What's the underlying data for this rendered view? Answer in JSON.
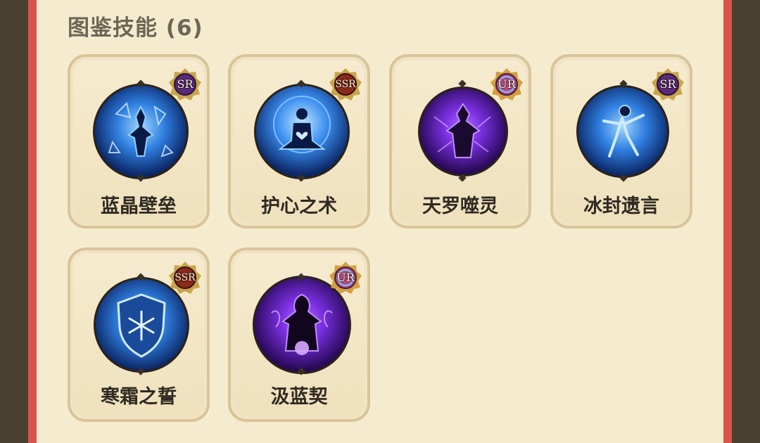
{
  "section": {
    "title": "图鉴技能 (6)"
  },
  "skills": [
    {
      "name": "蓝晶壁垒",
      "rarity": "SR",
      "icon": "crystal-guardian-icon"
    },
    {
      "name": "护心之术",
      "rarity": "SSR",
      "icon": "meditation-heart-icon"
    },
    {
      "name": "天罗噬灵",
      "rarity": "UR",
      "icon": "shadow-warrior-icon"
    },
    {
      "name": "冰封遗言",
      "rarity": "SR",
      "icon": "ice-spirit-icon"
    },
    {
      "name": "寒霜之誓",
      "rarity": "SSR",
      "icon": "frost-shield-icon"
    },
    {
      "name": "汲蓝契",
      "rarity": "UR",
      "icon": "dark-sorcerer-icon"
    }
  ],
  "colors": {
    "panel": "#f5ecd0",
    "border_red": "#d9534a",
    "ice_blue": "#2f7fe0",
    "void_purple": "#7a2fe0",
    "sr_badge": "#5b2a7a",
    "ssr_badge": "#8a2a1a",
    "ur_badge": "#c04a8a"
  }
}
